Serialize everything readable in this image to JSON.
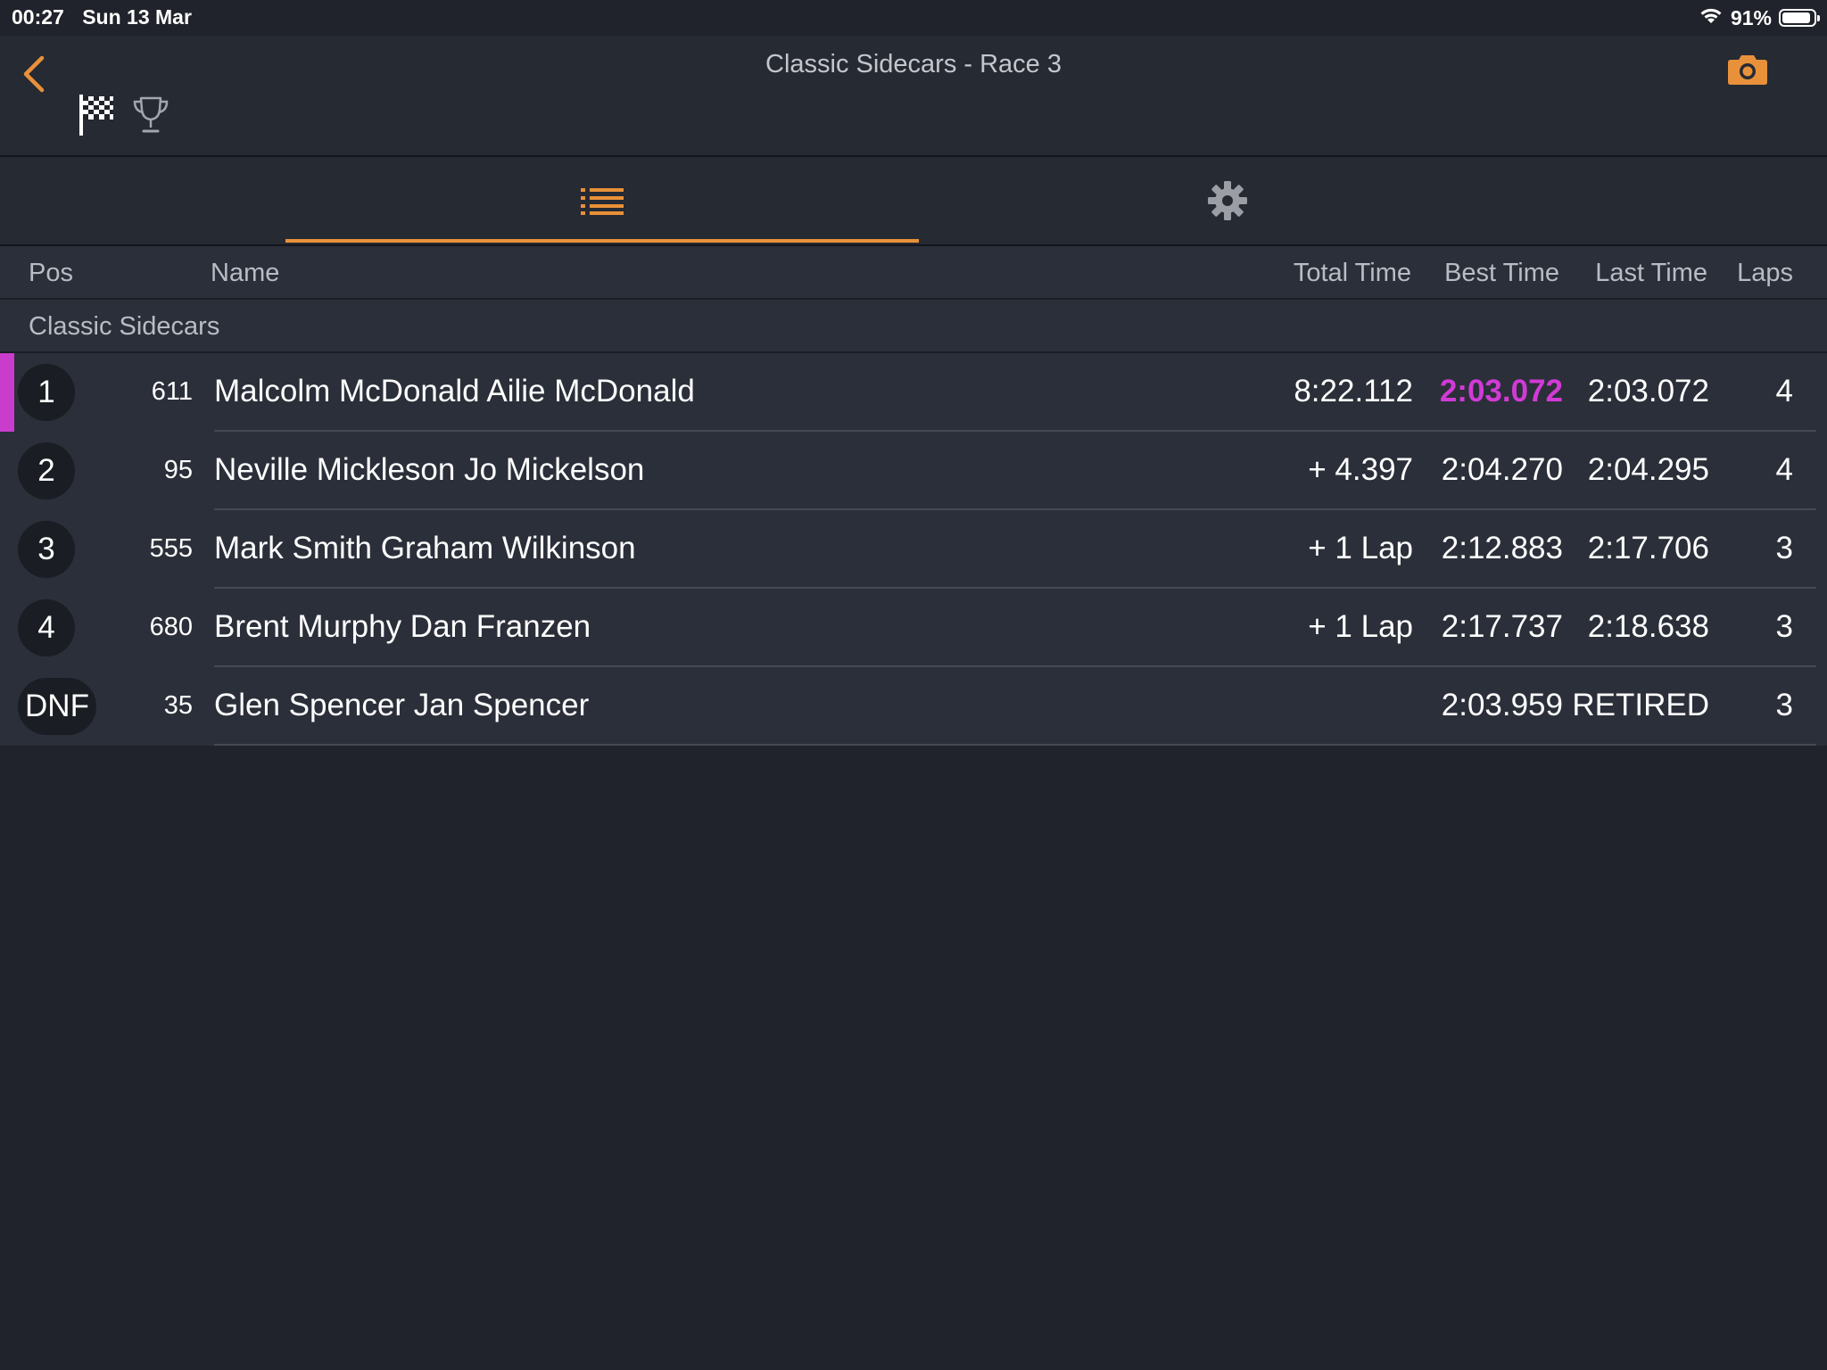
{
  "status_bar": {
    "time": "00:27",
    "date": "Sun 13 Mar",
    "battery_percent": "91%",
    "battery_level": 0.91
  },
  "header": {
    "title": "Classic Sidecars - Race 3",
    "icons": {
      "back": "chevron-left-icon",
      "camera": "camera-icon",
      "flag": "checkered-flag-icon",
      "trophy": "trophy-icon"
    }
  },
  "tabs": [
    {
      "icon": "list-icon",
      "active": true
    },
    {
      "icon": "gear-icon",
      "active": false
    }
  ],
  "columns": {
    "pos": "Pos",
    "name": "Name",
    "total_time": "Total Time",
    "best_time": "Best Time",
    "last_time": "Last Time",
    "laps": "Laps"
  },
  "group": "Classic Sidecars",
  "colors": {
    "accent": "#e8913a",
    "fastest_lap": "#d23ad6",
    "background": "#20232b",
    "row": "#2b2f39"
  },
  "results": [
    {
      "pos": "1",
      "number": "611",
      "name": "Malcolm McDonald Ailie McDonald",
      "total": "8:22.112",
      "best": "2:03.072",
      "last": "2:03.072",
      "laps": "4",
      "fastest": true
    },
    {
      "pos": "2",
      "number": "95",
      "name": "Neville Mickleson Jo Mickelson",
      "total": "+ 4.397",
      "best": "2:04.270",
      "last": "2:04.295",
      "laps": "4",
      "fastest": false
    },
    {
      "pos": "3",
      "number": "555",
      "name": "Mark Smith Graham Wilkinson",
      "total": "+ 1 Lap",
      "best": "2:12.883",
      "last": "2:17.706",
      "laps": "3",
      "fastest": false
    },
    {
      "pos": "4",
      "number": "680",
      "name": "Brent Murphy Dan Franzen",
      "total": "+ 1 Lap",
      "best": "2:17.737",
      "last": "2:18.638",
      "laps": "3",
      "fastest": false
    },
    {
      "pos": "DNF",
      "number": "35",
      "name": "Glen Spencer Jan Spencer",
      "total": "",
      "best": "2:03.959",
      "last": "RETIRED",
      "laps": "3",
      "fastest": false
    }
  ]
}
